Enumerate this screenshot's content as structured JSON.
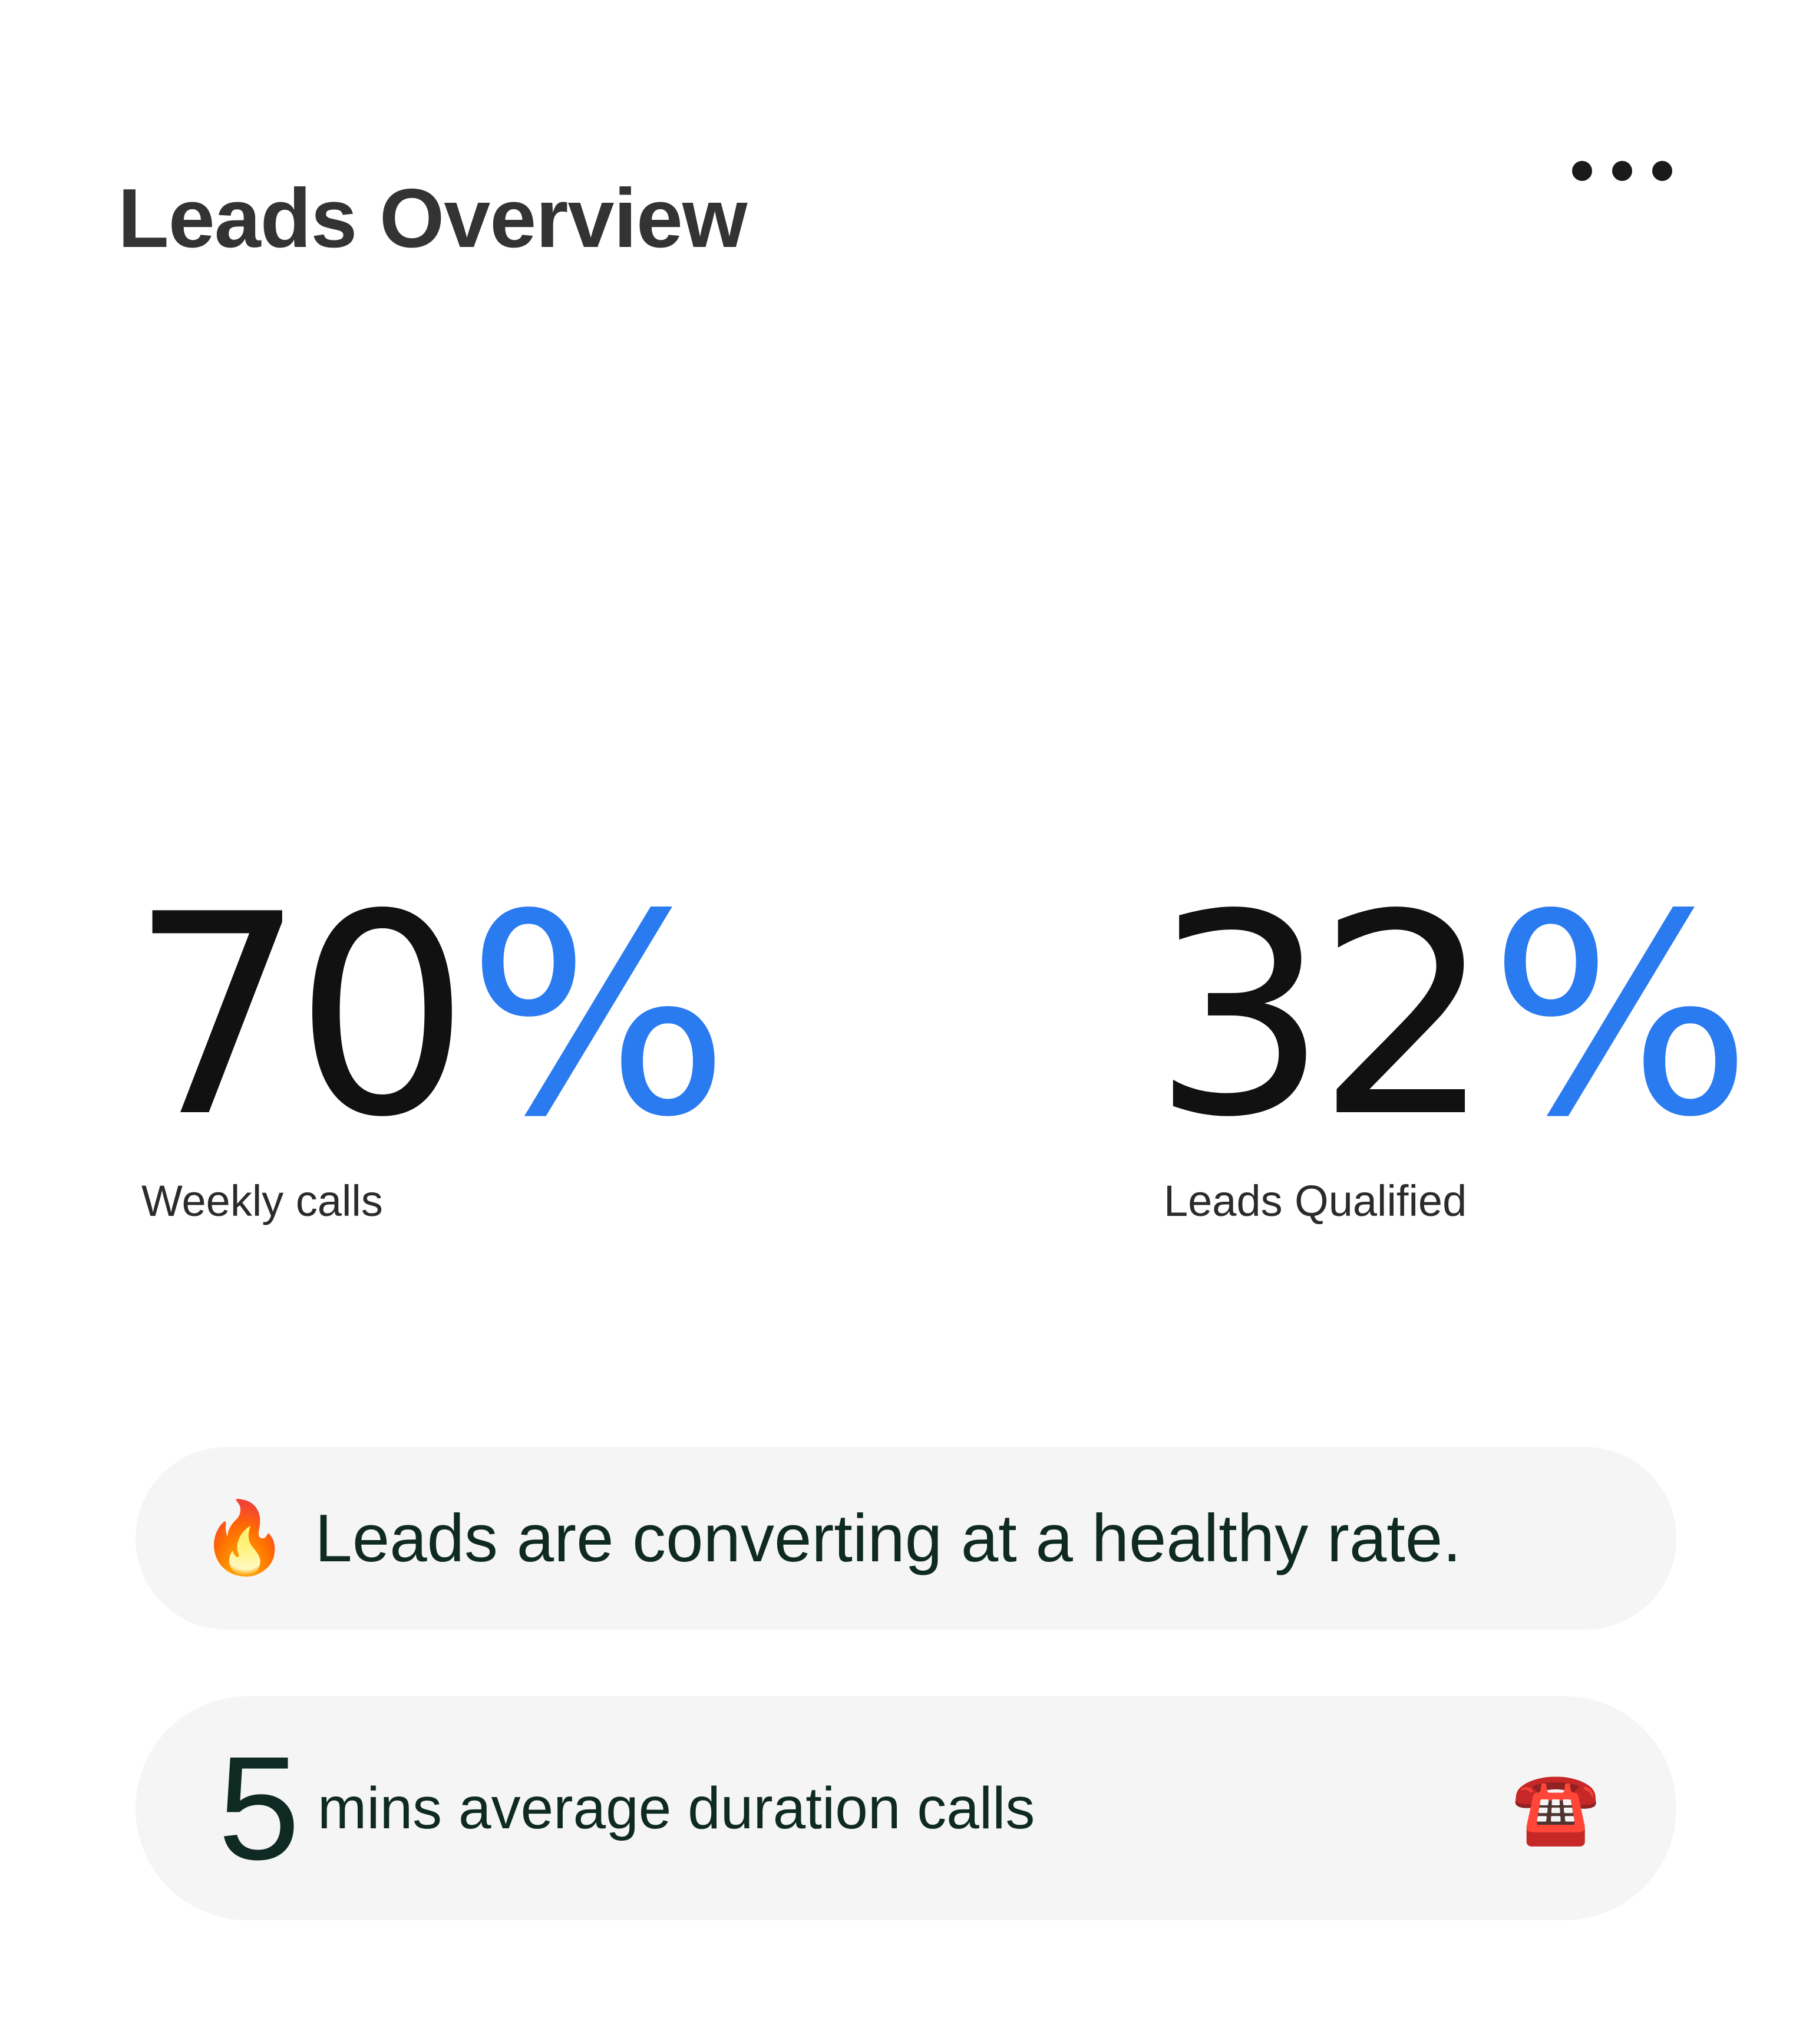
{
  "header": {
    "title": "Leads Overview",
    "menu_icon": "more-horizontal-icon"
  },
  "stats": [
    {
      "value": "70",
      "unit": "%",
      "label": "Weekly calls"
    },
    {
      "value": "32",
      "unit": "%",
      "label": "Leads Qualified"
    }
  ],
  "insight": {
    "icon": "fire-icon",
    "emoji": "🔥",
    "text": "Leads are converting at a healthy rate."
  },
  "duration": {
    "value": "5",
    "text": "mins average duration calls",
    "icon": "telephone-icon",
    "emoji": "☎️"
  },
  "colors": {
    "accent": "#2a7af0",
    "text_dark": "#0f2a22",
    "pill_background": "#f5f5f5"
  }
}
